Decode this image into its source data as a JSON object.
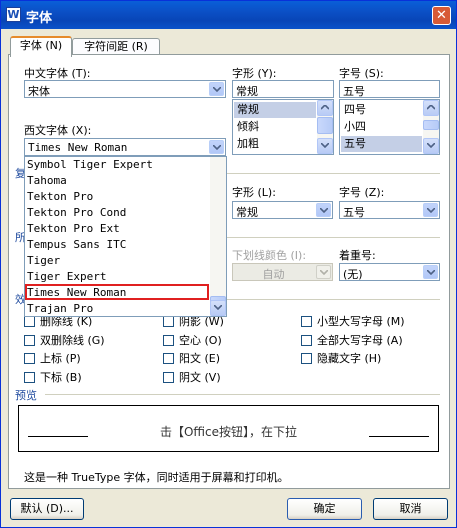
{
  "window": {
    "title": "字体",
    "app_icon": "word-icon",
    "close_icon": "close-icon"
  },
  "tabs": [
    {
      "label": "字体 (N)"
    },
    {
      "label": "字符间距 (R)"
    }
  ],
  "chinese_font": {
    "label": "中文字体 (T):",
    "value": "宋体"
  },
  "style": {
    "label": "字形 (Y):",
    "value": "常规",
    "options": [
      "常规",
      "倾斜",
      "加粗"
    ],
    "selected": "常规"
  },
  "size": {
    "label": "字号 (S):",
    "value": "五号",
    "options": [
      "四号",
      "小四",
      "五号"
    ],
    "selected": "五号"
  },
  "western_font": {
    "label": "西文字体 (X):",
    "value": "Times New Roman"
  },
  "style2": {
    "label": "字形 (L):",
    "value": "常规"
  },
  "size2": {
    "label": "字号 (Z):",
    "value": "五号"
  },
  "underline_color": {
    "label": "下划线颜色 (I):",
    "value": "自动"
  },
  "emphasis": {
    "label": "着重号:",
    "value": "(无)"
  },
  "font_dropdown": {
    "items": [
      "Symbol Tiger Expert",
      "Tahoma",
      "Tekton Pro",
      "Tekton Pro Cond",
      "Tekton Pro Ext",
      "Tempus Sans ITC",
      "Tiger",
      "Tiger Expert",
      "Times New Roman",
      "Trajan Pro"
    ],
    "highlighted": "Times New Roman"
  },
  "partial_labels": {
    "complex": "复",
    "all": "所",
    "effects": "效"
  },
  "effects": {
    "col1": [
      "删除线 (K)",
      "双删除线 (G)",
      "上标 (P)",
      "下标 (B)"
    ],
    "col2": [
      "阴影 (W)",
      "空心 (O)",
      "阳文 (E)",
      "阴文 (V)"
    ],
    "col3": [
      "小型大写字母 (M)",
      "全部大写字母 (A)",
      "隐藏文字 (H)"
    ]
  },
  "preview": {
    "label": "预览",
    "text": "击【Office按钮】，在下拉"
  },
  "info_text": "这是一种 TrueType 字体，同时适用于屏幕和打印机。",
  "buttons": {
    "default": "默认 (D)...",
    "ok": "确定",
    "cancel": "取消"
  }
}
